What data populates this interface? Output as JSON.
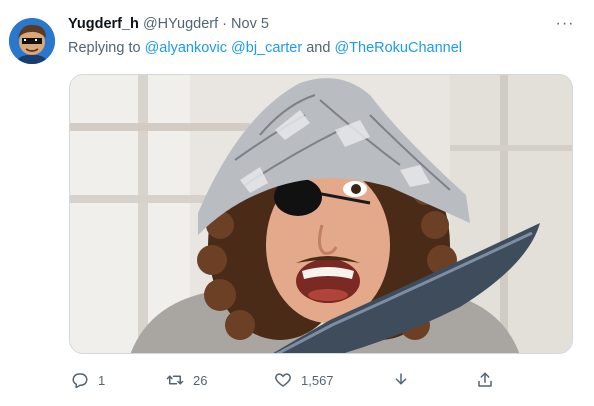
{
  "tweet": {
    "display_name": "Yugderf_h",
    "handle": "@HYugderf",
    "separator": "·",
    "date": "Nov 5",
    "more_label": "···",
    "reply": {
      "prefix": "Replying to",
      "mention1": "@alyankovic",
      "mention2": "@bj_carter",
      "conjunction": "and",
      "mention3": "@TheRokuChannel"
    }
  },
  "actions": {
    "replies": "1",
    "retweets": "26",
    "likes": "1,567"
  },
  "icons": {
    "reply": "reply-icon",
    "retweet": "retweet-icon",
    "like": "heart-icon",
    "download": "download-icon",
    "share": "share-icon",
    "more": "more-icon"
  },
  "colors": {
    "link": "#1d9bf0",
    "secondary_text": "#536471",
    "primary_text": "#0f1419"
  }
}
